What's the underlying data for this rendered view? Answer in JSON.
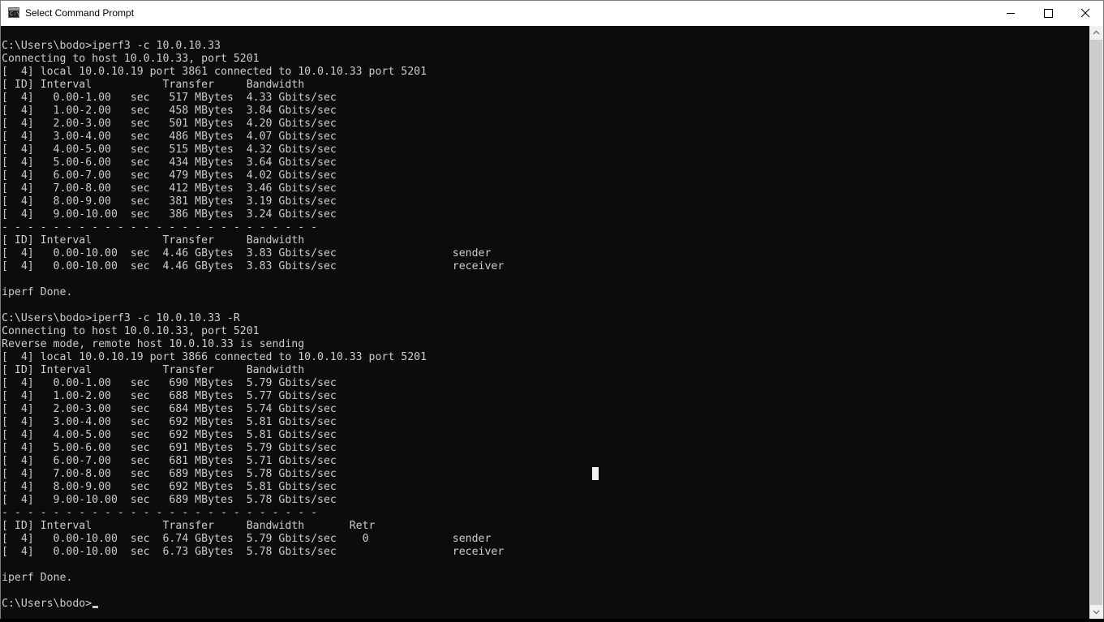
{
  "window": {
    "title": "Select Command Prompt",
    "icon": "cmd-icon",
    "icon_glyph": "C:\\",
    "controls": {
      "minimize": "minimize-icon",
      "maximize": "maximize-icon",
      "close": "close-icon"
    }
  },
  "console": {
    "background_color": "#0c0c0c",
    "text_color": "#cccccc",
    "lines": [
      "C:\\Users\\bodo>iperf3 -c 10.0.10.33",
      "Connecting to host 10.0.10.33, port 5201",
      "[  4] local 10.0.10.19 port 3861 connected to 10.0.10.33 port 5201",
      "[ ID] Interval           Transfer     Bandwidth",
      "[  4]   0.00-1.00   sec   517 MBytes  4.33 Gbits/sec",
      "[  4]   1.00-2.00   sec   458 MBytes  3.84 Gbits/sec",
      "[  4]   2.00-3.00   sec   501 MBytes  4.20 Gbits/sec",
      "[  4]   3.00-4.00   sec   486 MBytes  4.07 Gbits/sec",
      "[  4]   4.00-5.00   sec   515 MBytes  4.32 Gbits/sec",
      "[  4]   5.00-6.00   sec   434 MBytes  3.64 Gbits/sec",
      "[  4]   6.00-7.00   sec   479 MBytes  4.02 Gbits/sec",
      "[  4]   7.00-8.00   sec   412 MBytes  3.46 Gbits/sec",
      "[  4]   8.00-9.00   sec   381 MBytes  3.19 Gbits/sec",
      "[  4]   9.00-10.00  sec   386 MBytes  3.24 Gbits/sec",
      "- - - - - - - - - - - - - - - - - - - - - - - - -",
      "[ ID] Interval           Transfer     Bandwidth",
      "[  4]   0.00-10.00  sec  4.46 GBytes  3.83 Gbits/sec                  sender",
      "[  4]   0.00-10.00  sec  4.46 GBytes  3.83 Gbits/sec                  receiver",
      "",
      "iperf Done.",
      "",
      "C:\\Users\\bodo>iperf3 -c 10.0.10.33 -R",
      "Connecting to host 10.0.10.33, port 5201",
      "Reverse mode, remote host 10.0.10.33 is sending",
      "[  4] local 10.0.10.19 port 3866 connected to 10.0.10.33 port 5201",
      "[ ID] Interval           Transfer     Bandwidth",
      "[  4]   0.00-1.00   sec   690 MBytes  5.79 Gbits/sec",
      "[  4]   1.00-2.00   sec   688 MBytes  5.77 Gbits/sec",
      "[  4]   2.00-3.00   sec   684 MBytes  5.74 Gbits/sec",
      "[  4]   3.00-4.00   sec   692 MBytes  5.81 Gbits/sec",
      "[  4]   4.00-5.00   sec   692 MBytes  5.81 Gbits/sec",
      "[  4]   5.00-6.00   sec   691 MBytes  5.79 Gbits/sec",
      "[  4]   6.00-7.00   sec   681 MBytes  5.71 Gbits/sec",
      "[  4]   7.00-8.00   sec   689 MBytes  5.78 Gbits/sec",
      "[  4]   8.00-9.00   sec   692 MBytes  5.81 Gbits/sec",
      "[  4]   9.00-10.00  sec   689 MBytes  5.78 Gbits/sec",
      "- - - - - - - - - - - - - - - - - - - - - - - - -",
      "[ ID] Interval           Transfer     Bandwidth       Retr",
      "[  4]   0.00-10.00  sec  6.74 GBytes  5.79 Gbits/sec    0             sender",
      "[  4]   0.00-10.00  sec  6.73 GBytes  5.78 Gbits/sec                  receiver",
      "",
      "iperf Done.",
      ""
    ],
    "prompt": "C:\\Users\\bodo>"
  },
  "scrollbar": {
    "up_icon": "scroll-up-arrow-icon",
    "down_icon": "scroll-down-arrow-icon"
  }
}
